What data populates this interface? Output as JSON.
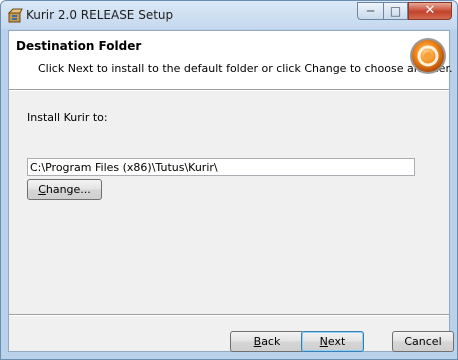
{
  "window": {
    "title": "Kurir 2.0 RELEASE Setup",
    "icons": {
      "app": "installer-box-icon",
      "minimize": "minimize-icon",
      "maximize": "maximize-icon",
      "close": "close-icon"
    }
  },
  "banner": {
    "title": "Destination Folder",
    "description": "Click Next to install to the default folder or click Change to choose another.",
    "logo_icon": "kurir-logo-icon"
  },
  "main": {
    "install_label": "Install Kurir to:",
    "install_path": "C:\\Program Files (x86)\\Tutus\\Kurir\\",
    "change_button": {
      "mnemonic": "C",
      "rest": "hange..."
    }
  },
  "footer": {
    "back_button": {
      "mnemonic": "B",
      "rest": "ack"
    },
    "next_button": {
      "mnemonic": "N",
      "rest": "ext"
    },
    "cancel_button": "Cancel"
  },
  "colors": {
    "accent_logo_orange": "#f28a1a",
    "close_button_red": "#c4432b",
    "default_button_border": "#3c7fb1"
  }
}
